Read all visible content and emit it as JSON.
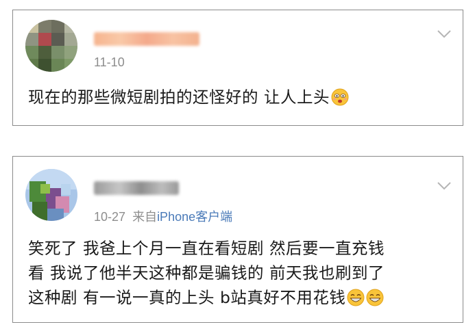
{
  "comments": [
    {
      "time": "11-10",
      "source": "",
      "source_prefix": "",
      "lines": [
        "现在的那些微短剧拍的还怪好的  让人上头"
      ],
      "emoji": "surprised-face-icon"
    },
    {
      "time": "10-27",
      "source_prefix": "来自",
      "source": "iPhone客户端",
      "lines": [
        "笑死了 我爸上个月一直在看短剧 然后要一直充钱",
        "看 我说了他半天这种都是骗钱的  前天我也刷到了",
        "这种剧 有一说一真的上头 b站真好不用花钱"
      ],
      "emoji": "grinning-face-icon"
    }
  ],
  "colors": {
    "border": "#8a8a8a",
    "meta": "#8d8d8d",
    "source_link": "#4a7ab8",
    "text": "#1a1a1a"
  }
}
